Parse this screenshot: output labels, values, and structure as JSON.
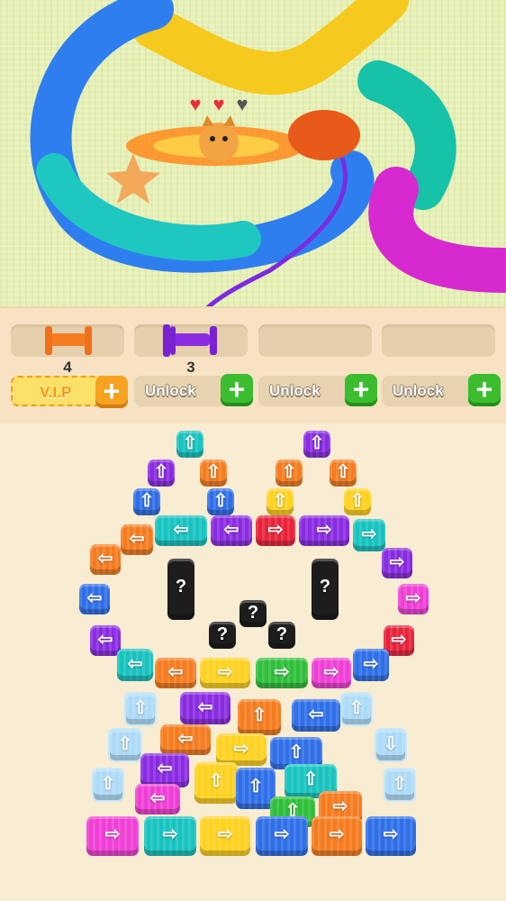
{
  "hearts": [
    {
      "state": "full",
      "color": "#ec2b3a"
    },
    {
      "state": "full",
      "color": "#ec2b3a"
    },
    {
      "state": "empty",
      "color": "#555555"
    }
  ],
  "spools": [
    {
      "count": "4",
      "color": "#f57c1f",
      "filled": true
    },
    {
      "count": "3",
      "color": "#8a2be2",
      "filled": true
    },
    {
      "count": "",
      "color": "",
      "filled": false
    },
    {
      "count": "",
      "color": "",
      "filled": false
    }
  ],
  "buttons": {
    "vip": {
      "label": "V.I.P",
      "plus": "+"
    },
    "unlock": [
      {
        "label": "Unlock",
        "plus": "+"
      },
      {
        "label": "Unlock",
        "plus": "+"
      },
      {
        "label": "Unlock",
        "plus": "+"
      }
    ]
  },
  "colors": {
    "teal": "#17c3bf",
    "purple": "#8a2be2",
    "orange": "#f57c1f",
    "yellow": "#ffd21f",
    "blue": "#2f6fe8",
    "red": "#e8223a",
    "green": "#2fbf3a",
    "pink": "#ef3fd5",
    "magenta": "#d62ad0",
    "ice": "#9fd8ff",
    "black": "#1d1d1d"
  },
  "tiles": [
    {
      "color": "teal",
      "dir": "up"
    },
    {
      "color": "purple",
      "dir": "up"
    },
    {
      "color": "purple",
      "dir": "up"
    },
    {
      "color": "orange",
      "dir": "up"
    },
    {
      "color": "orange",
      "dir": "up"
    },
    {
      "color": "orange",
      "dir": "up"
    },
    {
      "color": "blue",
      "dir": "up"
    },
    {
      "color": "blue",
      "dir": "up"
    },
    {
      "color": "yellow",
      "dir": "up"
    },
    {
      "color": "yellow",
      "dir": "up"
    },
    {
      "color": "teal",
      "dir": "left"
    },
    {
      "color": "purple",
      "dir": "left"
    },
    {
      "color": "red",
      "dir": "right"
    },
    {
      "color": "purple",
      "dir": "right"
    },
    {
      "color": "orange",
      "dir": "left"
    },
    {
      "color": "orange",
      "dir": "left"
    },
    {
      "color": "teal",
      "dir": "right"
    },
    {
      "color": "purple",
      "dir": "right"
    },
    {
      "color": "blue",
      "dir": "left"
    },
    {
      "color": "pink",
      "dir": "right"
    },
    {
      "color": "purple",
      "dir": "left"
    },
    {
      "color": "red",
      "dir": "right"
    },
    {
      "color": "teal",
      "dir": "left"
    },
    {
      "color": "blue",
      "dir": "right"
    },
    {
      "color": "orange",
      "dir": "left"
    },
    {
      "color": "yellow",
      "dir": "right"
    },
    {
      "color": "green",
      "dir": "right"
    },
    {
      "color": "pink",
      "dir": "right"
    },
    {
      "color": "black",
      "dir": "?"
    },
    {
      "color": "black",
      "dir": "?"
    },
    {
      "color": "black",
      "dir": "?"
    },
    {
      "color": "black",
      "dir": "?"
    },
    {
      "color": "black",
      "dir": "?"
    },
    {
      "color": "ice",
      "dir": "up"
    },
    {
      "color": "ice",
      "dir": "up"
    },
    {
      "color": "ice",
      "dir": "up"
    },
    {
      "color": "ice",
      "dir": "down"
    },
    {
      "color": "ice",
      "dir": "up"
    },
    {
      "color": "ice",
      "dir": "up"
    },
    {
      "color": "purple",
      "dir": "left"
    },
    {
      "color": "orange",
      "dir": "up"
    },
    {
      "color": "blue",
      "dir": "left"
    },
    {
      "color": "orange",
      "dir": "left"
    },
    {
      "color": "yellow",
      "dir": "right"
    },
    {
      "color": "blue",
      "dir": "up"
    },
    {
      "color": "purple",
      "dir": "left"
    },
    {
      "color": "yellow",
      "dir": "up"
    },
    {
      "color": "blue",
      "dir": "up"
    },
    {
      "color": "teal",
      "dir": "up"
    },
    {
      "color": "orange",
      "dir": "right"
    },
    {
      "color": "pink",
      "dir": "left"
    },
    {
      "color": "green",
      "dir": "up"
    },
    {
      "color": "pink",
      "dir": "right"
    },
    {
      "color": "teal",
      "dir": "right"
    },
    {
      "color": "yellow",
      "dir": "right"
    },
    {
      "color": "blue",
      "dir": "right"
    },
    {
      "color": "orange",
      "dir": "right"
    },
    {
      "color": "blue",
      "dir": "right"
    }
  ]
}
